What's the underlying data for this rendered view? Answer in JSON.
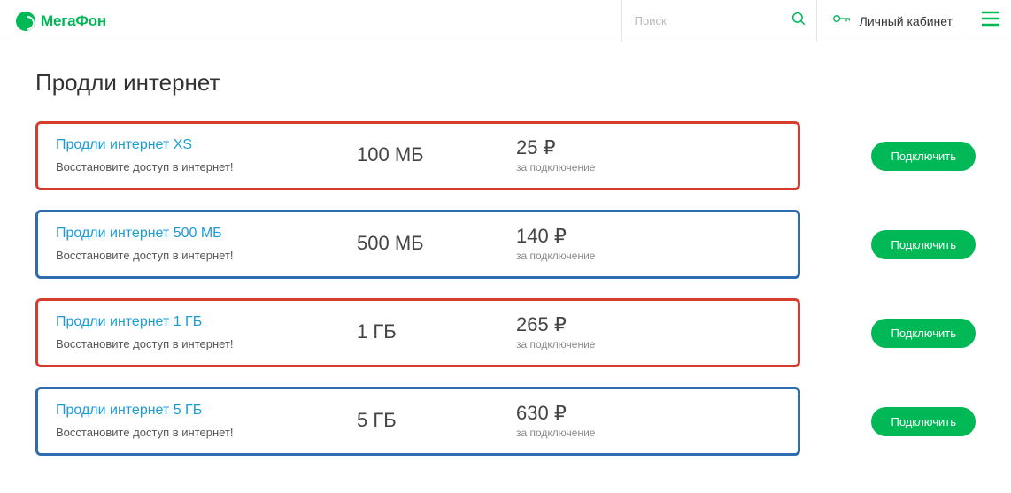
{
  "header": {
    "brand": "МегаФон",
    "search_placeholder": "Поиск",
    "cabinet_label": "Личный кабинет"
  },
  "page": {
    "title": "Продли интернет"
  },
  "plans": [
    {
      "name": "Продли интернет XS",
      "desc": "Восстановите доступ в интернет!",
      "volume": "100 МБ",
      "price": "25 ₽",
      "note": "за подключение",
      "button": "Подключить",
      "color": "red"
    },
    {
      "name": "Продли интернет 500 МБ",
      "desc": "Восстановите доступ в интернет!",
      "volume": "500 МБ",
      "price": "140 ₽",
      "note": "за подключение",
      "button": "Подключить",
      "color": "blue"
    },
    {
      "name": "Продли интернет 1 ГБ",
      "desc": "Восстановите доступ в интернет!",
      "volume": "1 ГБ",
      "price": "265 ₽",
      "note": "за подключение",
      "button": "Подключить",
      "color": "red"
    },
    {
      "name": "Продли интернет 5 ГБ",
      "desc": "Восстановите доступ в интернет!",
      "volume": "5 ГБ",
      "price": "630 ₽",
      "note": "за подключение",
      "button": "Подключить",
      "color": "blue"
    }
  ]
}
